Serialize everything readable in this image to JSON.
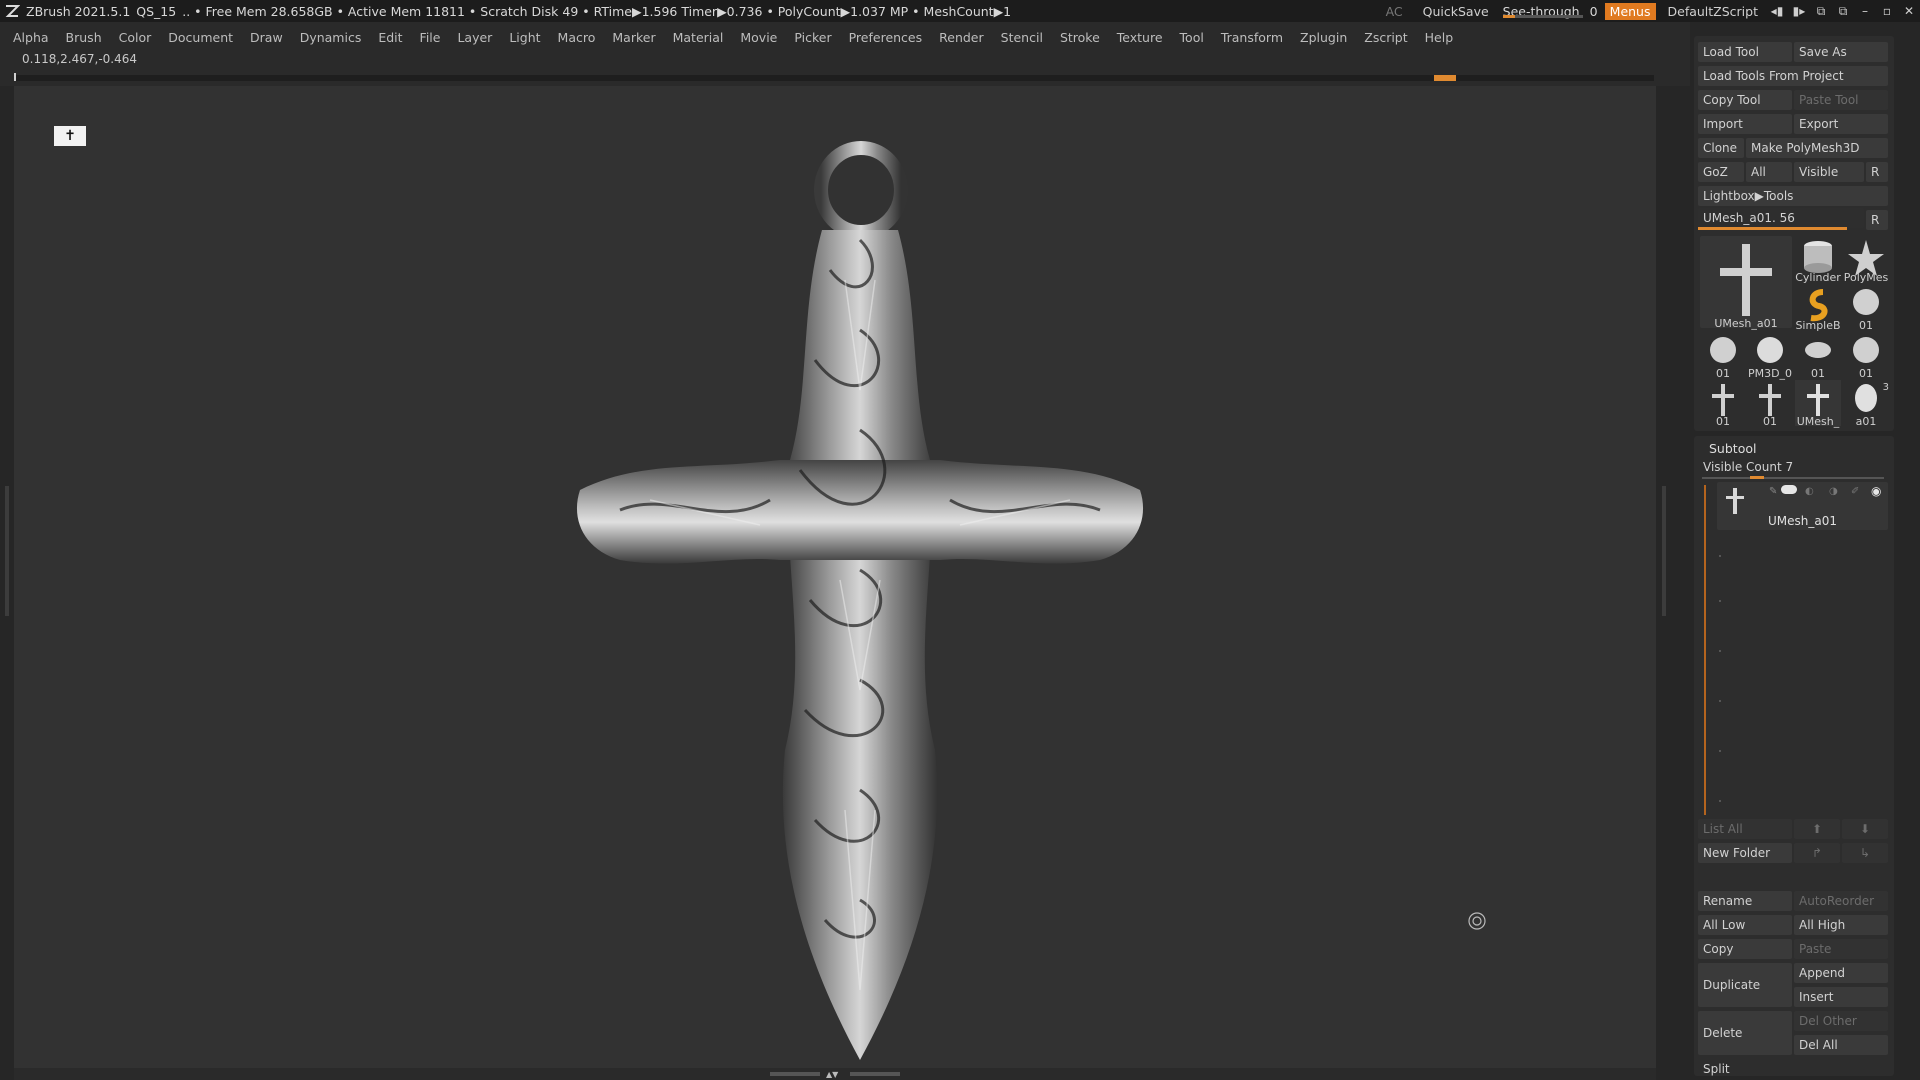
{
  "titlebar": {
    "app": "ZBrush 2021.5.1",
    "project": "QS_15",
    "stats": ".. • Free Mem 28.658GB • Active Mem 11811 • Scratch Disk 49 •  RTime▶1.596 Timer▶0.736 • PolyCount▶1.037 MP  • MeshCount▶1",
    "ac": "AC",
    "quicksave": "QuickSave",
    "see_through_label": "See-through",
    "see_through_value": "0",
    "see_through_level": 0.15,
    "menus": "Menus",
    "script": "DefaultZScript"
  },
  "menubar": [
    "Alpha",
    "Brush",
    "Color",
    "Document",
    "Draw",
    "Dynamics",
    "Edit",
    "File",
    "Layer",
    "Light",
    "Macro",
    "Marker",
    "Material",
    "Movie",
    "Picker",
    "Preferences",
    "Render",
    "Stencil",
    "Stroke",
    "Texture",
    "Tool",
    "Transform",
    "Zplugin",
    "Zscript",
    "Help"
  ],
  "coords": "0.118,2.467,-0.464",
  "tool": {
    "load_tool": "Load Tool",
    "save_as": "Save As",
    "load_from_project": "Load Tools From Project",
    "copy_tool": "Copy Tool",
    "paste_tool": "Paste Tool",
    "import": "Import",
    "export": "Export",
    "clone": "Clone",
    "make_polymesh": "Make PolyMesh3D",
    "goz": "GoZ",
    "all": "All",
    "visible": "Visible",
    "r": "R",
    "lightbox": "Lightbox▶Tools",
    "current_tool": "UMesh_a01. 56",
    "current_slider": 0.9,
    "thumbs": [
      "UMesh_a01",
      "Cylinder",
      "PolyMes",
      "SimpleB",
      "01",
      "01",
      "PM3D_0",
      "01",
      "01",
      "01",
      "01",
      "UMesh_",
      "a01"
    ],
    "thumb_badge": "3"
  },
  "subtool": {
    "title": "Subtool",
    "visible_count": "Visible Count 7",
    "visible_slider": 0.3,
    "item_name": "UMesh_a01",
    "list_all": "List All",
    "new_folder": "New Folder",
    "rename": "Rename",
    "auto_reorder": "AutoReorder",
    "all_low": "All Low",
    "all_high": "All High",
    "copy": "Copy",
    "paste": "Paste",
    "duplicate": "Duplicate",
    "append": "Append",
    "insert": "Insert",
    "delete": "Delete",
    "del_other": "Del Other",
    "del_all": "Del All",
    "split": "Split"
  },
  "colors": {
    "accent": "#e08a30",
    "menus_bg": "#e07a20",
    "bg": "#2a2a2a",
    "viewport": "#323232"
  }
}
